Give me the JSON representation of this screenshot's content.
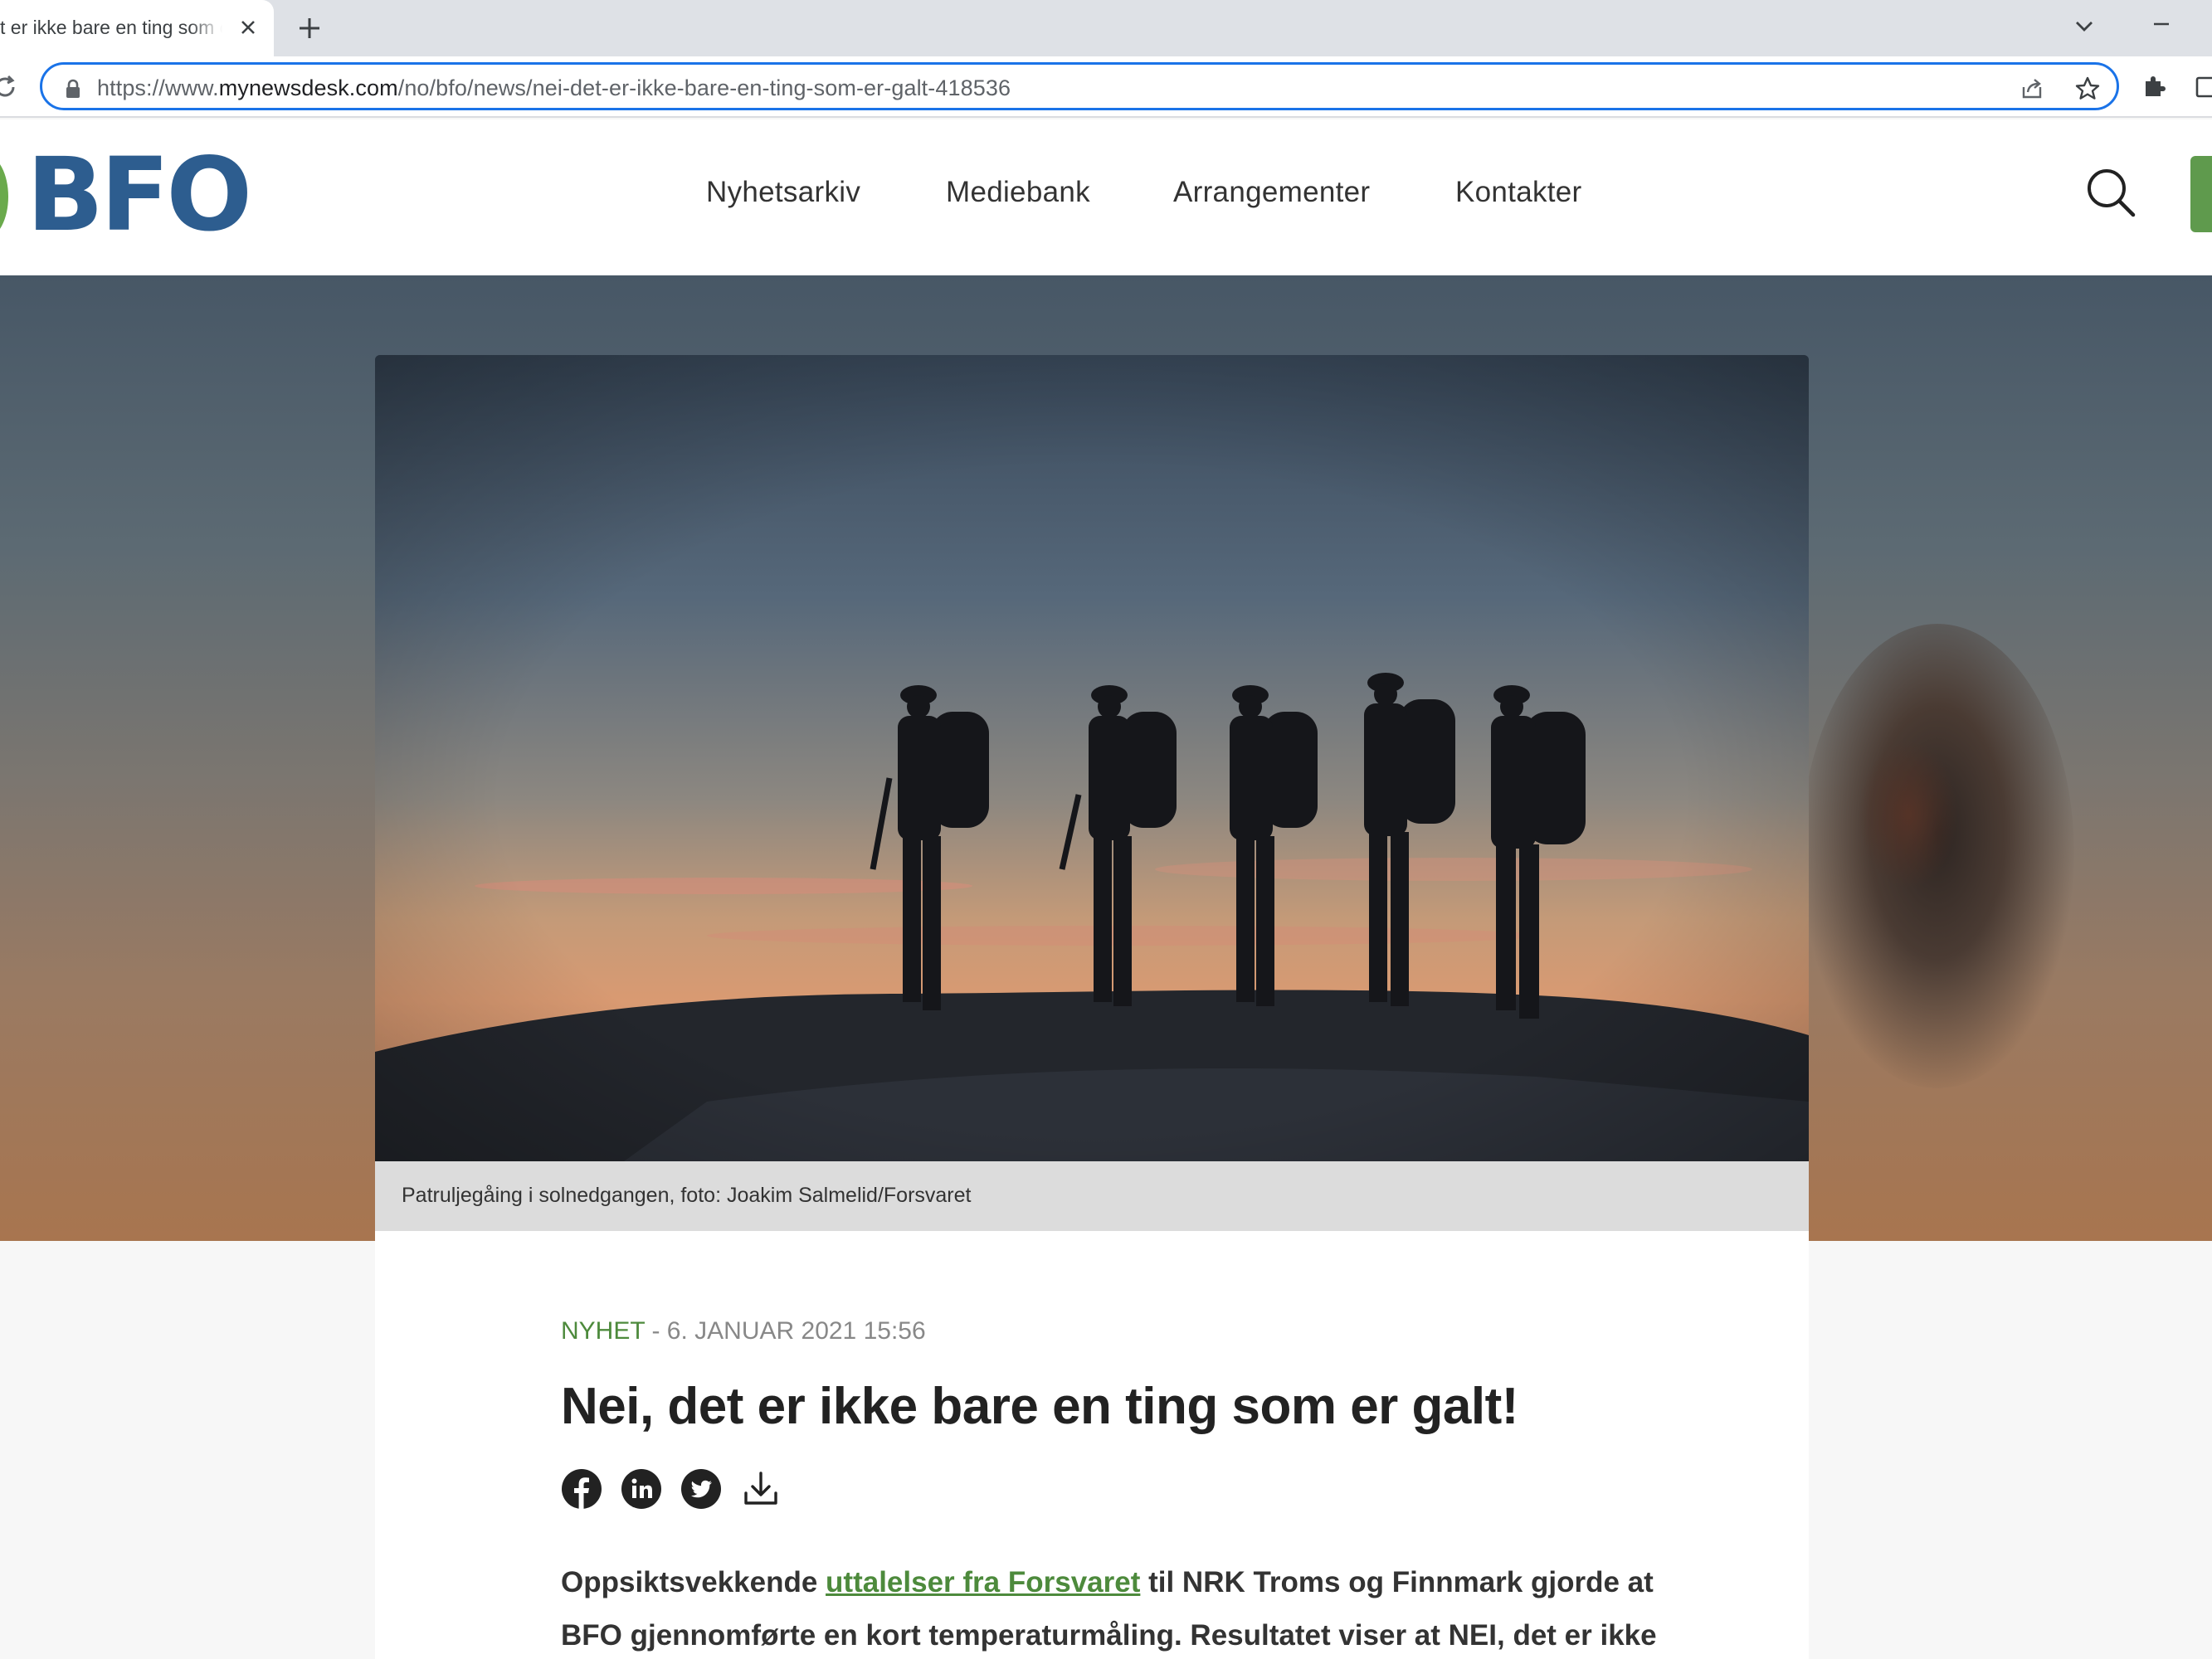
{
  "browser": {
    "tab_title": "t er ikke bare en ting som er galt!",
    "url_prefix": "https://www.",
    "url_domain": "mynewsdesk.com",
    "url_path": "/no/bfo/news/nei-det-er-ikke-bare-en-ting-som-er-galt-418536"
  },
  "site": {
    "logo": "BFO",
    "nav": [
      "Nyhetsarkiv",
      "Mediebank",
      "Arrangementer",
      "Kontakter"
    ]
  },
  "hero": {
    "caption": "Patruljegåing i solnedgangen, foto: Joakim Salmelid/Forsvaret"
  },
  "article": {
    "category": "NYHET",
    "date": " - 6. JANUAR 2021 15:56",
    "title": "Nei, det er ikke bare en ting som er galt!",
    "share_icons": [
      "facebook-icon",
      "linkedin-icon",
      "twitter-icon",
      "download-icon"
    ],
    "intro_before_link": "Oppsiktsvekkende ",
    "intro_link": "uttalelser fra Forsvaret",
    "intro_after_link": " til NRK Troms og Finnmark gjorde at BFO gjennomførte en kort temperaturmåling. Resultatet viser at NEI, det er ikke bare en"
  },
  "colors": {
    "brand_blue": "#2d5d8f",
    "brand_green": "#6aaa4c",
    "link_green": "#4d8a3c",
    "focus_blue": "#1a73e8"
  }
}
